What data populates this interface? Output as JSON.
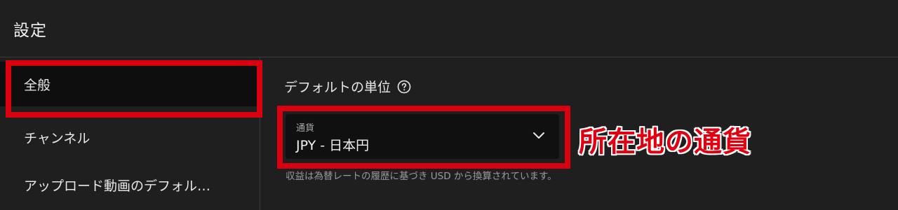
{
  "header": {
    "title": "設定"
  },
  "sidebar": {
    "items": [
      {
        "label": "全般",
        "active": true
      },
      {
        "label": "チャンネル",
        "active": false
      },
      {
        "label": "アップロード動画のデフォル…",
        "active": false
      }
    ]
  },
  "main": {
    "section_title": "デフォルトの単位",
    "currency_select": {
      "caption": "通貨",
      "value": "JPY - 日本円"
    },
    "helper_text": "収益は為替レートの履歴に基づき USD から換算されています。"
  },
  "annotation": {
    "text": "所在地の通貨",
    "color": "#d9000f"
  },
  "icons": {
    "help": "help-circle-icon",
    "dropdown": "chevron-down-icon"
  }
}
